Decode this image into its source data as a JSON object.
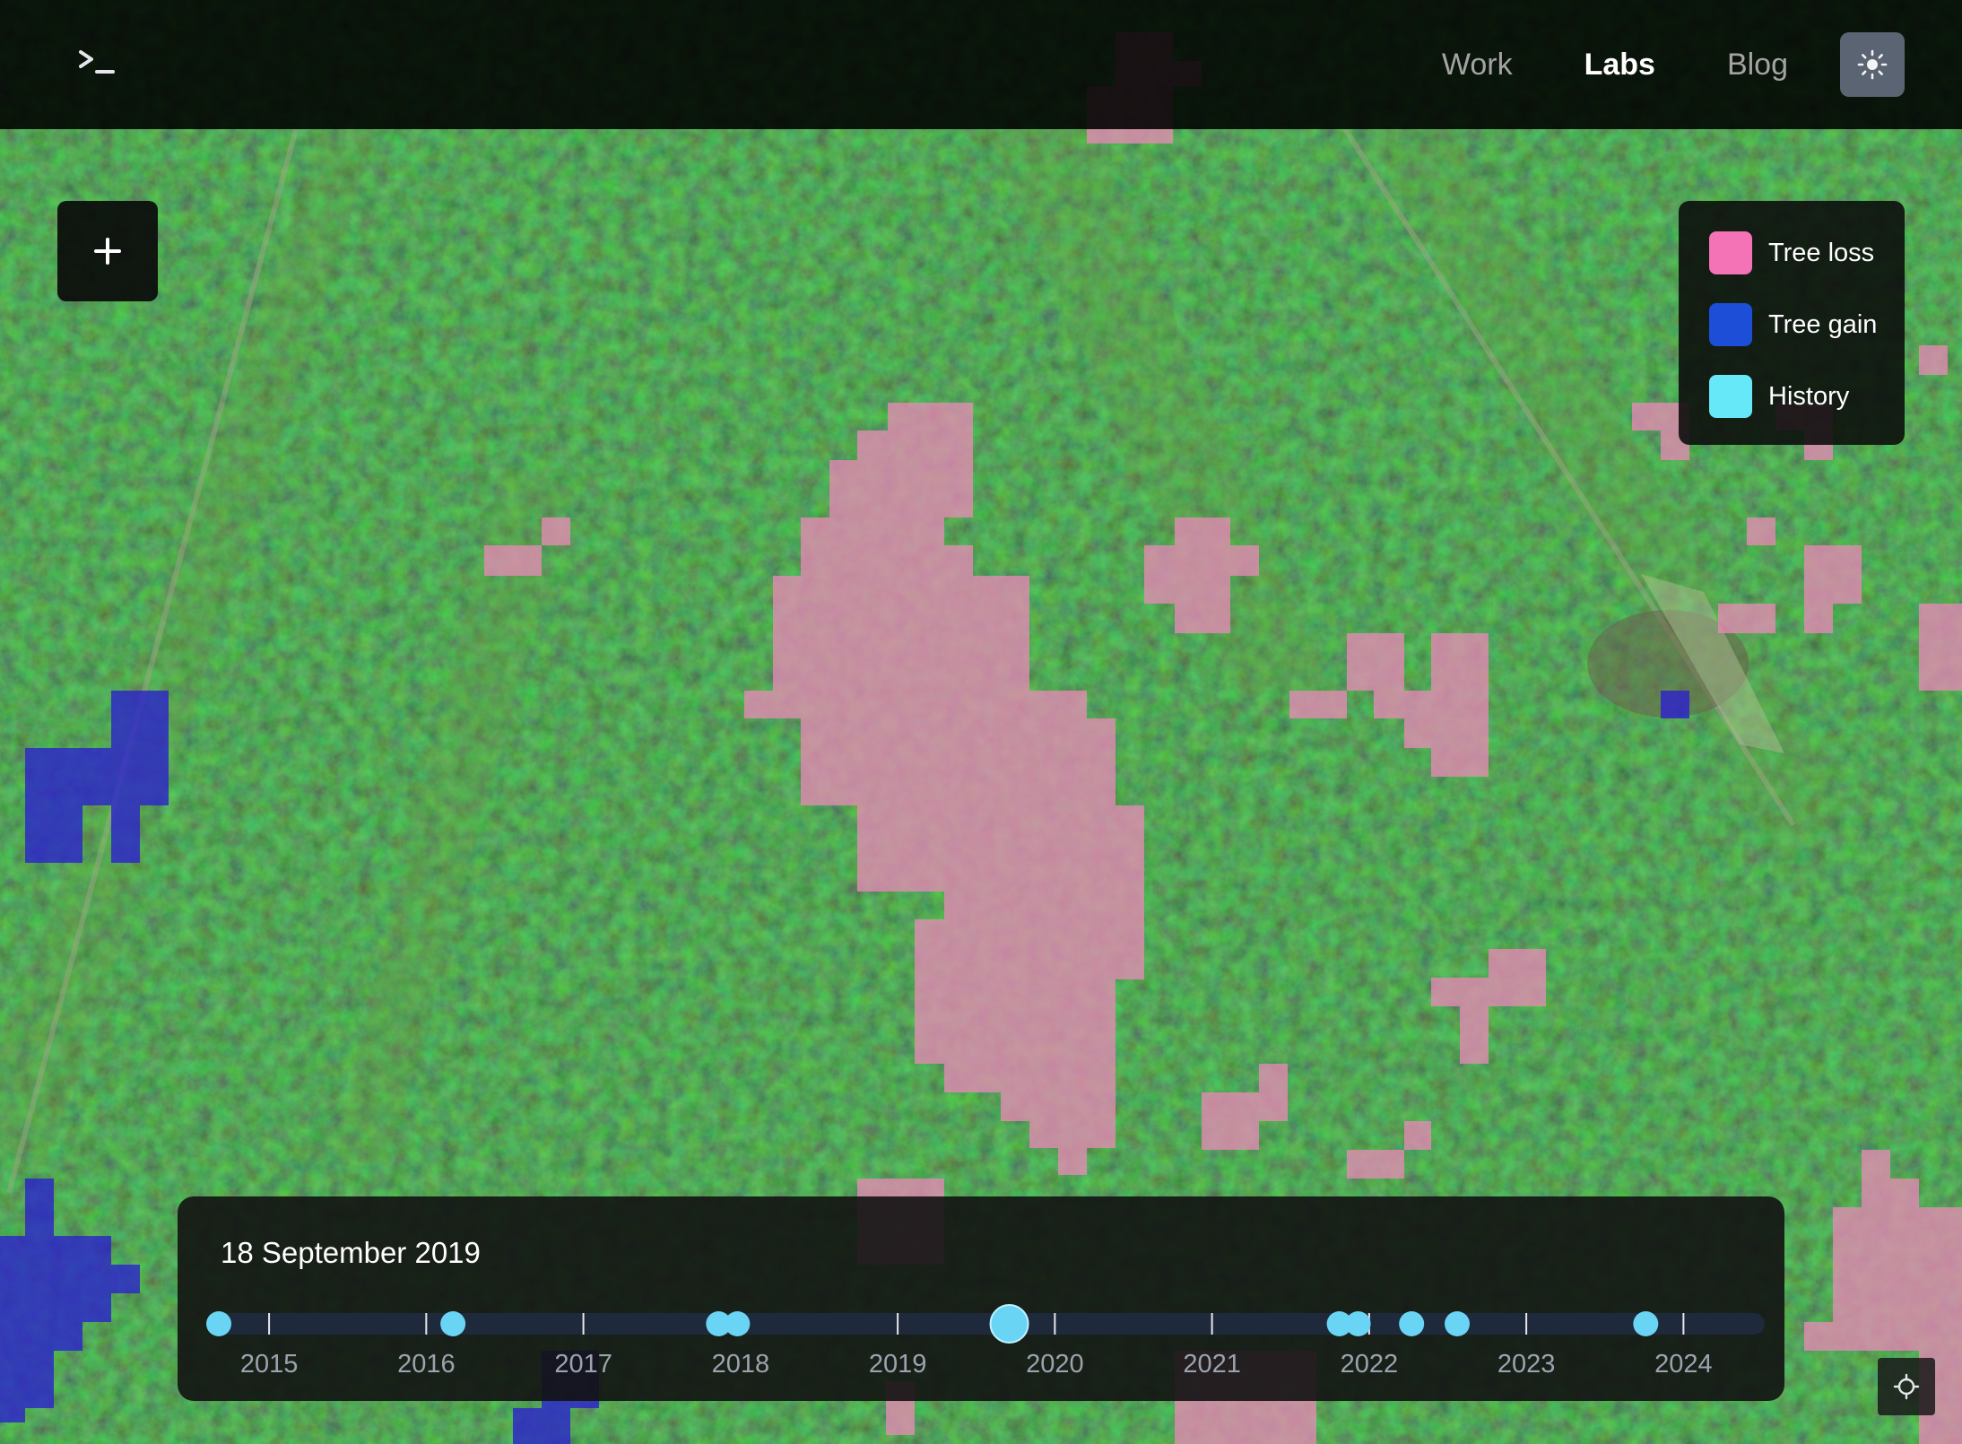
{
  "header": {
    "terminal_icon": "terminal-icon",
    "nav": [
      {
        "label": "Work",
        "active": false
      },
      {
        "label": "Labs",
        "active": true
      },
      {
        "label": "Blog",
        "active": false
      }
    ],
    "theme_icon": "sun-icon"
  },
  "map": {
    "zoom_in_icon": "plus-icon",
    "locate_icon": "crosshair-icon",
    "colors": {
      "tree_loss": "#f472b6",
      "tree_gain": "#1d4ed8",
      "history": "#67e8f9"
    }
  },
  "legend": {
    "items": [
      {
        "label": "Tree loss",
        "color": "#f472b6"
      },
      {
        "label": "Tree gain",
        "color": "#1d4ed8"
      },
      {
        "label": "History",
        "color": "#67e8f9"
      }
    ]
  },
  "timeline": {
    "date": "18 September 2019",
    "start_year": 2014.68,
    "end_year": 2024.46,
    "years": [
      "2015",
      "2016",
      "2017",
      "2018",
      "2019",
      "2020",
      "2021",
      "2022",
      "2023",
      "2024"
    ],
    "events": [
      2014.68,
      2016.17,
      2017.86,
      2017.98,
      2019.71,
      2021.81,
      2021.93,
      2022.27,
      2022.56,
      2023.76
    ],
    "selected": 2019.71,
    "dot_color": "#6ad4f4",
    "track_color": "#1e293b"
  }
}
